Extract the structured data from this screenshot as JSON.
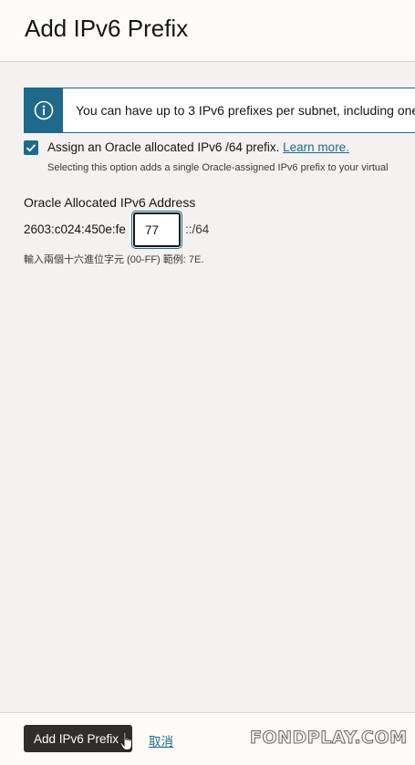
{
  "header": {
    "title": "Add IPv6 Prefix"
  },
  "info_banner": {
    "message": "You can have up to 3 IPv6 prefixes per subnet, including one"
  },
  "assign_option": {
    "checked": true,
    "label": "Assign an Oracle allocated IPv6 /64 prefix.",
    "link_text": "Learn more.",
    "help_text": "Selecting this option adds a single Oracle-assigned IPv6 prefix to your virtual"
  },
  "address": {
    "label": "Oracle Allocated IPv6 Address",
    "prefix": "2603:c024:450e:fe",
    "value": "77",
    "suffix": "::/64",
    "hint": "輸入兩個十六進位字元 (00-FF) 範例: 7E."
  },
  "footer": {
    "primary_label": "Add IPv6 Prefix",
    "cancel_label": "取消"
  },
  "watermark": "FONDPLAY.COM",
  "colors": {
    "accent": "#1f6a8a",
    "primary_button": "#312d2a",
    "background": "#f3f2f1"
  }
}
